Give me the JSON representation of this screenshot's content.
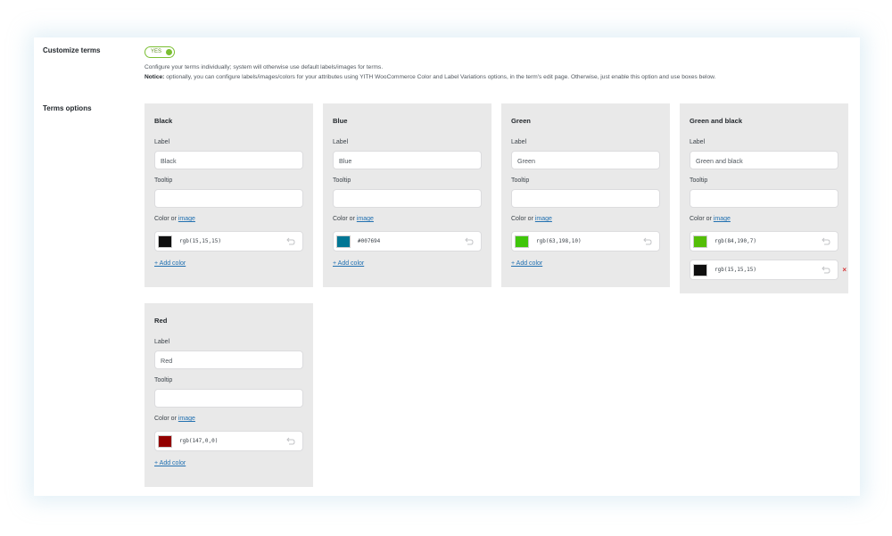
{
  "customize": {
    "label": "Customize terms",
    "toggle_text": "YES",
    "desc1": "Configure your terms individually; system will otherwise use default labels/images for terms.",
    "notice_bold": "Notice:",
    "notice_text": " optionally, you can configure labels/images/colors for your attributes using YITH WooCommerce Color and Label Variations options, in the term's edit page. Otherwise, just enable this option and use boxes below."
  },
  "terms_label": "Terms options",
  "field_labels": {
    "label": "Label",
    "tooltip": "Tooltip",
    "color_or": "Color or ",
    "image_link": "image",
    "add_color": "+ Add color"
  },
  "terms": [
    {
      "title": "Black",
      "label_value": "Black",
      "tooltip_value": "",
      "colors": [
        {
          "value": "rgb(15,15,15)",
          "hex": "#0f0f0f"
        }
      ]
    },
    {
      "title": "Blue",
      "label_value": "Blue",
      "tooltip_value": "",
      "colors": [
        {
          "value": "#007694",
          "hex": "#007694"
        }
      ]
    },
    {
      "title": "Green",
      "label_value": "Green",
      "tooltip_value": "",
      "colors": [
        {
          "value": "rgb(63,198,10)",
          "hex": "#3fc60a"
        }
      ]
    },
    {
      "title": "Green and black",
      "label_value": "Green and black",
      "tooltip_value": "",
      "colors": [
        {
          "value": "rgb(84,190,7)",
          "hex": "#54be07"
        },
        {
          "value": "rgb(15,15,15)",
          "hex": "#0f0f0f"
        }
      ]
    },
    {
      "title": "Red",
      "label_value": "Red",
      "tooltip_value": "",
      "colors": [
        {
          "value": "rgb(147,0,0)",
          "hex": "#930000"
        }
      ]
    }
  ],
  "icons": {
    "undo": "undo-icon",
    "remove": "remove-color-icon",
    "toggle": "toggle-on-icon"
  },
  "colors": {
    "accent": "#2271b1",
    "toggle": "#7bbf33",
    "remove": "#d63638",
    "card_bg": "#e9e9e9"
  }
}
